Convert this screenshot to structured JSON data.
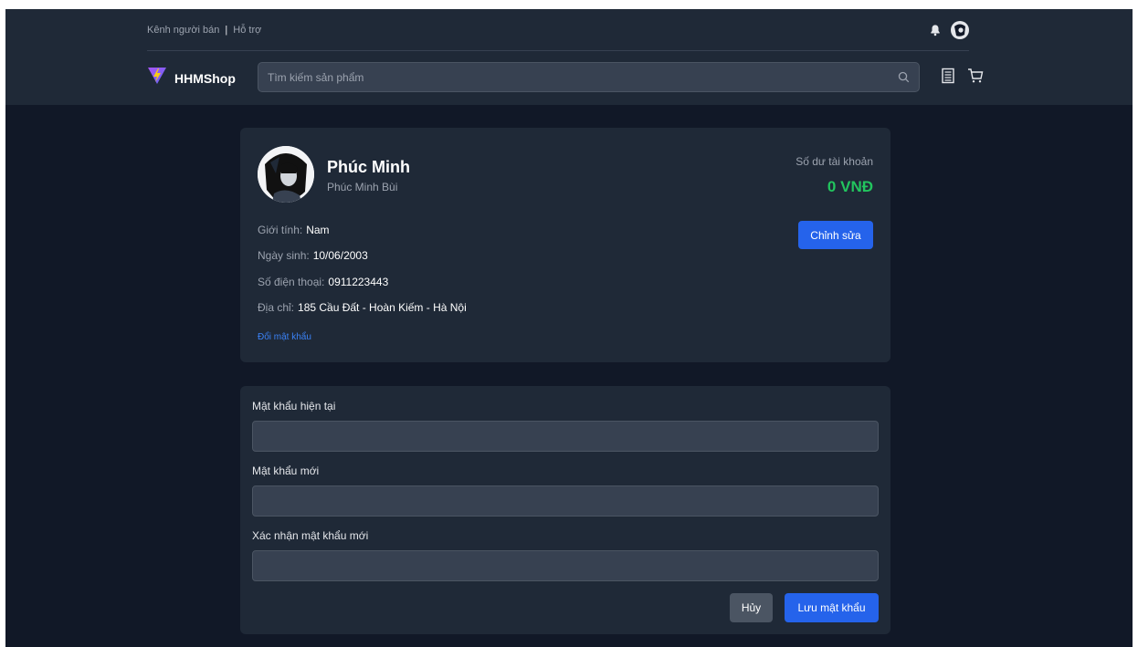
{
  "topbar": {
    "seller_channel": "Kênh người bán",
    "separator": "|",
    "support": "Hỗ trợ"
  },
  "header": {
    "brand": "HHMShop",
    "search_placeholder": "Tìm kiếm sản phẩm",
    "icons": [
      "bell-icon",
      "avatar",
      "search-icon",
      "orders-icon",
      "cart-icon"
    ]
  },
  "profile": {
    "display_name": "Phúc Minh",
    "full_name": "Phúc Minh Bùi",
    "balance_label": "Số dư tài khoản",
    "balance_value": "0 VNĐ",
    "edit_label": "Chỉnh sửa",
    "fields": [
      {
        "label": "Giới tính:",
        "value": "Nam"
      },
      {
        "label": "Ngày sinh:",
        "value": "10/06/2003"
      },
      {
        "label": "Số điện thoại:",
        "value": "0911223443"
      },
      {
        "label": "Địa chỉ:",
        "value": "185 Cầu Đất - Hoàn Kiếm - Hà Nội"
      }
    ],
    "change_password_link": "Đổi mật khẩu"
  },
  "password_form": {
    "current_label": "Mật khẩu hiện tại",
    "new_label": "Mật khẩu mới",
    "confirm_label": "Xác nhận mật khẩu mới",
    "current_value": "",
    "new_value": "",
    "confirm_value": "",
    "cancel_label": "Hủy",
    "save_label": "Lưu mật khẩu"
  },
  "colors": {
    "page_bg": "#111827",
    "card_bg": "#1f2937",
    "accent": "#2563eb",
    "balance": "#22c55e",
    "link": "#3b82f6"
  }
}
